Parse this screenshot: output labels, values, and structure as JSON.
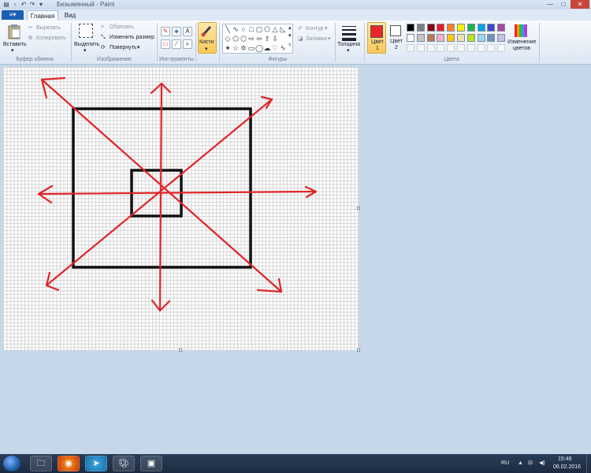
{
  "window": {
    "title": "Безымянный - Paint",
    "controls": [
      "—",
      "□",
      "✕"
    ]
  },
  "tabs": {
    "file_icon": "≡▾",
    "items": [
      "Главная",
      "Вид"
    ]
  },
  "ribbon": {
    "clipboard": {
      "group_label": "Буфер обмена",
      "paste": "Вставить",
      "cut": "Вырезать",
      "copy": "Копировать"
    },
    "image": {
      "group_label": "Изображение",
      "select": "Выделить",
      "crop": "Обрезать",
      "resize": "Изменить размер",
      "rotate": "Повернуть"
    },
    "tools": {
      "group_label": "Инструменты"
    },
    "brushes": {
      "label": "Кисти"
    },
    "shapes": {
      "group_label": "Фигуры",
      "outline": "Контур",
      "fill": "Заливка"
    },
    "size": {
      "label": "Толщина"
    },
    "colors": {
      "group_label": "Цвета",
      "color1": "Цвет 1",
      "color2": "Цвет 2",
      "edit": "Изменение цветов",
      "color1_value": "#e8262b",
      "color2_value": "#ffffff",
      "palette_row1": [
        "#000000",
        "#7f7f7f",
        "#880015",
        "#ed1c24",
        "#ff7f27",
        "#fff200",
        "#22b14c",
        "#00a2e8",
        "#3f48cc",
        "#a349a4"
      ],
      "palette_row2": [
        "#ffffff",
        "#c3c3c3",
        "#b97a57",
        "#ffaec9",
        "#ffc90e",
        "#efe4b0",
        "#b5e61d",
        "#99d9ea",
        "#7092be",
        "#c8bfe7"
      ]
    }
  },
  "drawing": {
    "stroke_colors": {
      "red": "#e02528",
      "black": "#111111"
    }
  },
  "taskbar": {
    "language": "RU",
    "time": "15:46",
    "date": "06.02.2016",
    "apps": [
      "explorer-icon",
      "firefox-icon",
      "telegram-icon",
      "paint-icon",
      "window-icon"
    ]
  }
}
